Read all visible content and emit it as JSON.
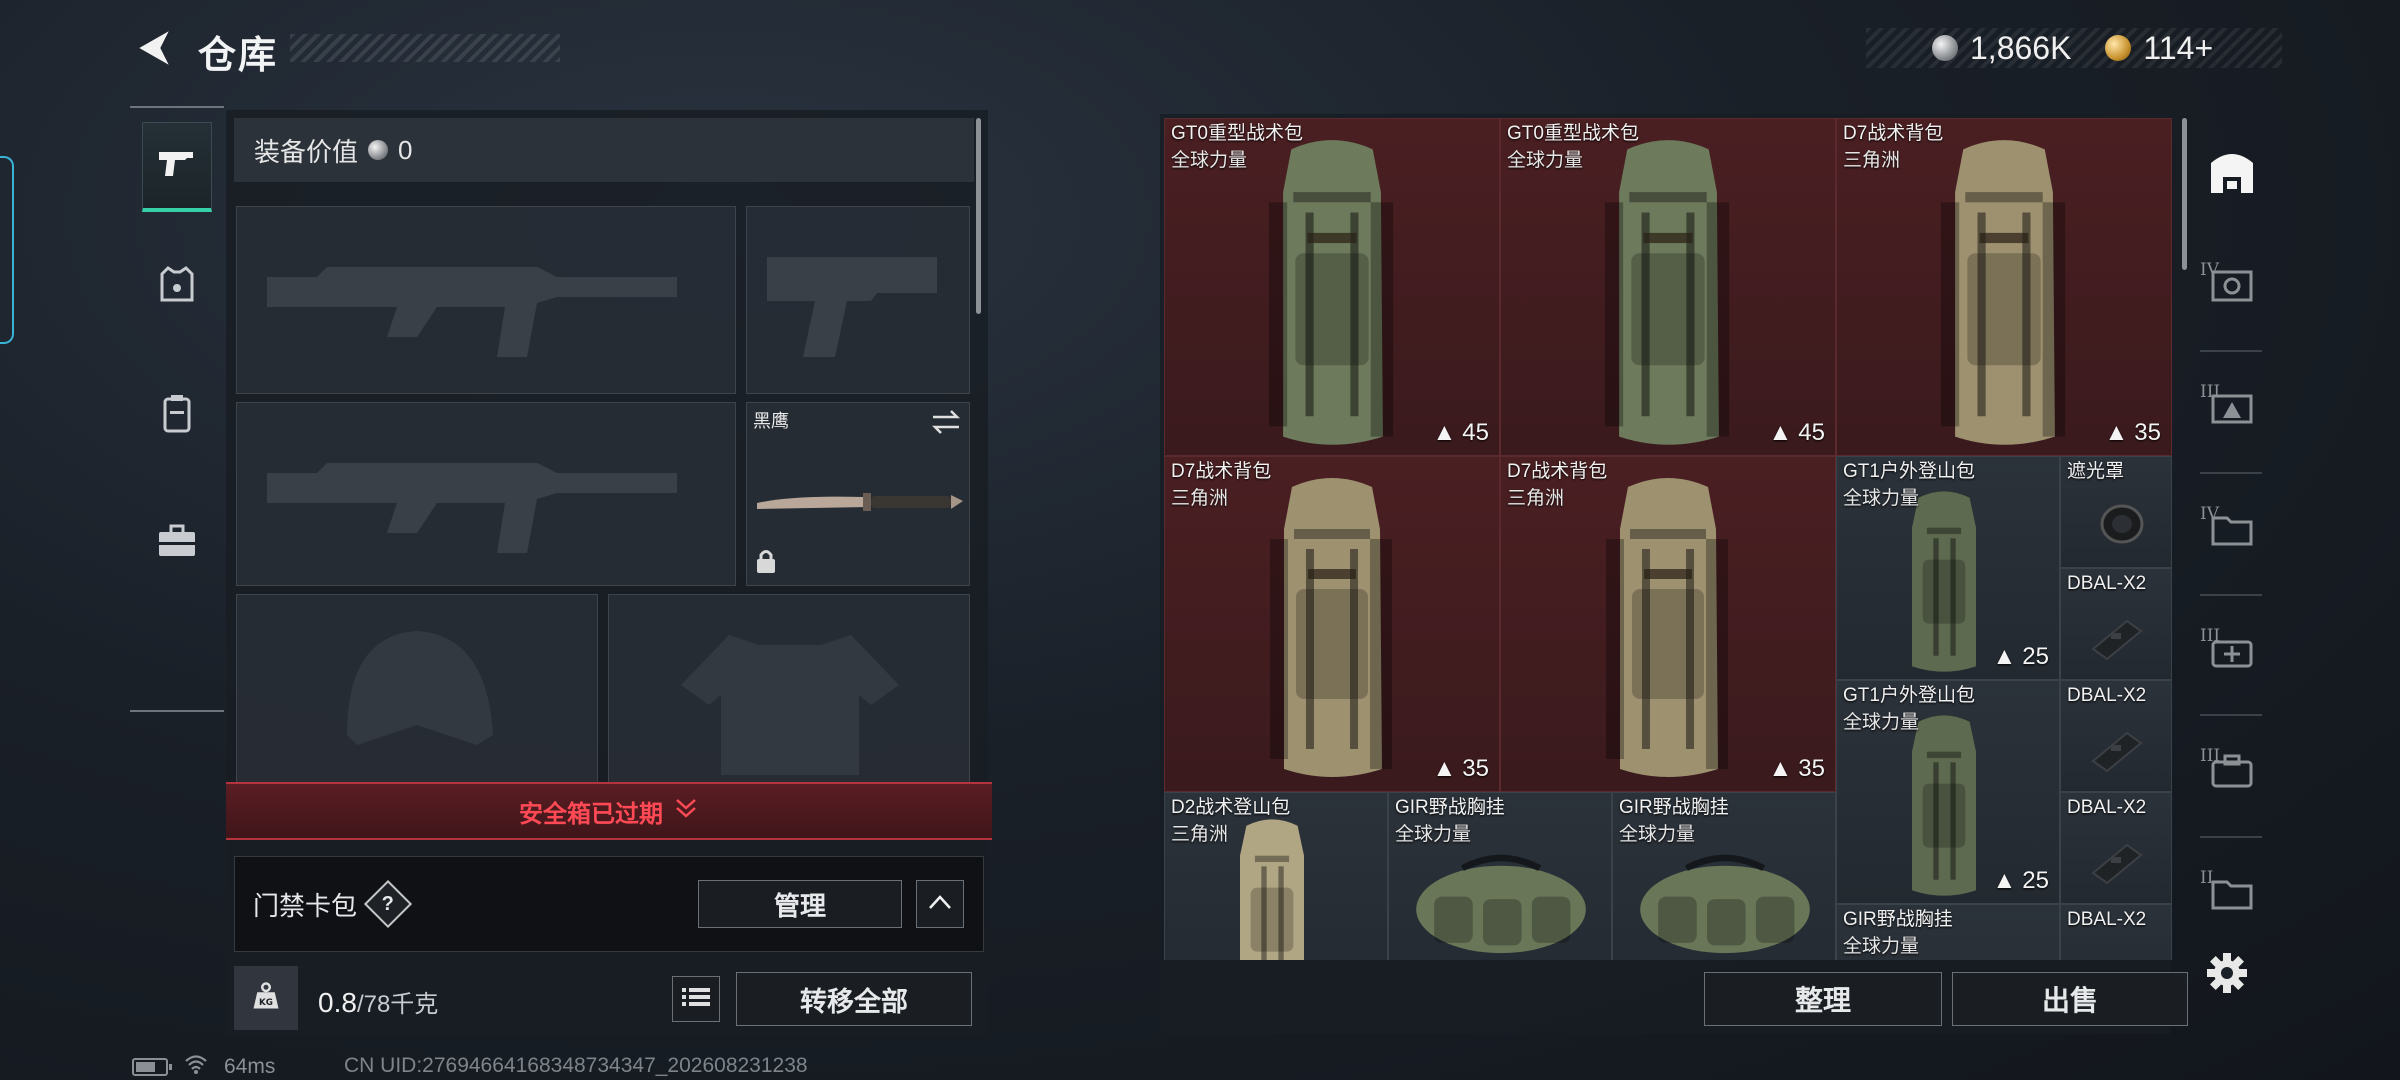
{
  "header": {
    "title": "仓库"
  },
  "currency": {
    "silver": "1,866K",
    "gold": "114+"
  },
  "equipment": {
    "value_label": "装备价值",
    "value": "0",
    "melee": {
      "name": "黑鹰"
    }
  },
  "safebox": {
    "status": "安全箱已过期"
  },
  "keycard": {
    "label": "门禁卡包",
    "help": "?",
    "manage": "管理"
  },
  "weight": {
    "current": "0.8",
    "max": "/78千克"
  },
  "actions": {
    "transfer_all": "转移全部",
    "sort": "整理",
    "sell": "出售"
  },
  "status": {
    "latency": "64ms",
    "uid": "CN UID:27694664168348734347_202608231238"
  },
  "inventory": {
    "cells": [
      {
        "name": "GT0重型战术包",
        "sub": "全球力量",
        "cap": "45"
      },
      {
        "name": "GT0重型战术包",
        "sub": "全球力量",
        "cap": "45"
      },
      {
        "name": "D7战术背包",
        "sub": "三角洲",
        "cap": "35"
      },
      {
        "name": "D7战术背包",
        "sub": "三角洲",
        "cap": "35"
      },
      {
        "name": "D7战术背包",
        "sub": "三角洲",
        "cap": "35"
      },
      {
        "name": "GT1户外登山包",
        "sub": "全球力量",
        "cap": "25"
      },
      {
        "name": "遮光罩"
      },
      {
        "name": "DBAL-X2"
      },
      {
        "name": "GT1户外登山包",
        "sub": "全球力量",
        "cap": "25"
      },
      {
        "name": "DBAL-X2"
      },
      {
        "name": "DBAL-X2"
      },
      {
        "name": "D2战术登山包",
        "sub": "三角洲"
      },
      {
        "name": "GIR野战胸挂",
        "sub": "全球力量"
      },
      {
        "name": "GIR野战胸挂",
        "sub": "全球力量"
      },
      {
        "name": "GIR野战胸挂",
        "sub": "全球力量"
      },
      {
        "name": "DBAL-X2"
      }
    ]
  },
  "right_tabs": [
    {
      "roman": ""
    },
    {
      "roman": "IV"
    },
    {
      "roman": "III"
    },
    {
      "roman": "IV"
    },
    {
      "roman": "III"
    },
    {
      "roman": "III"
    },
    {
      "roman": "II"
    }
  ],
  "colors": {
    "accent": "#36d1a6",
    "danger": "#ff4a55",
    "red_cell": "#4a1f22",
    "dark_cell": "#2b323a"
  }
}
